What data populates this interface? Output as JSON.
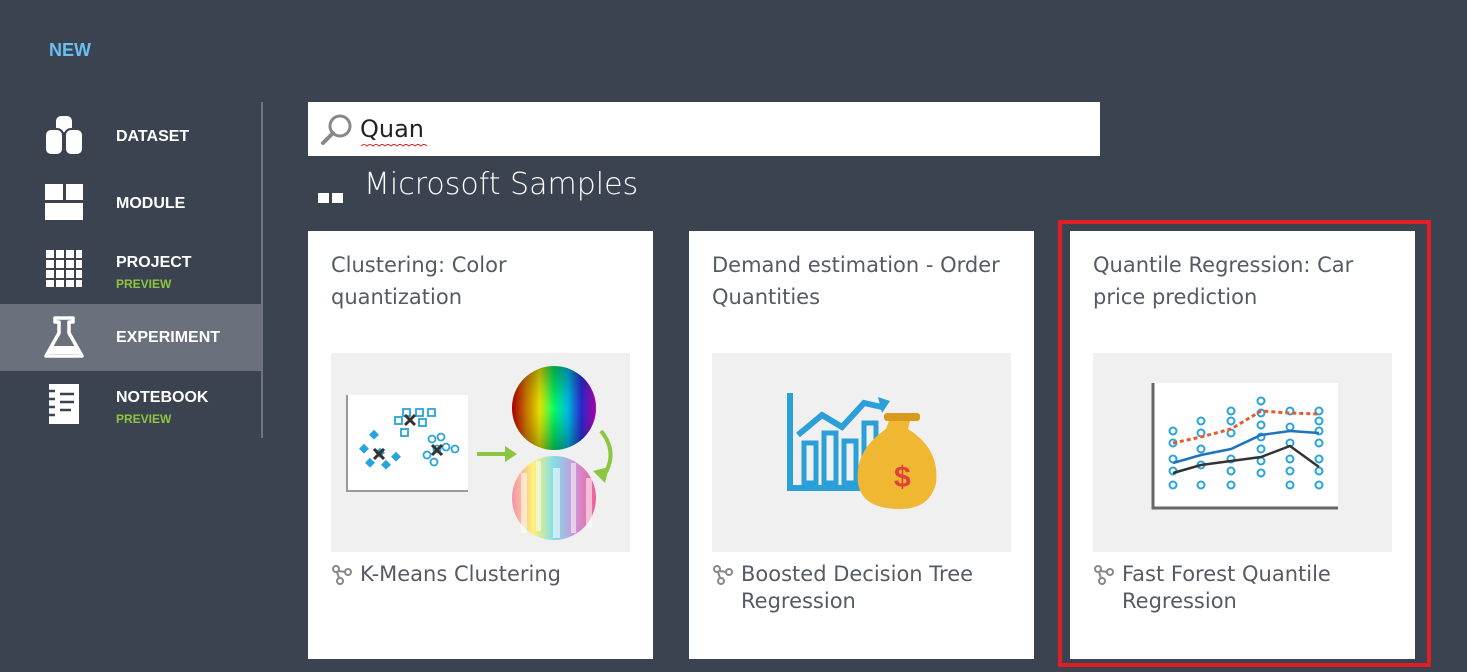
{
  "header": {
    "title": "NEW"
  },
  "nav": {
    "items": [
      {
        "label": "DATASET",
        "sub": "",
        "icon": "dataset-icon",
        "selected": false
      },
      {
        "label": "MODULE",
        "sub": "",
        "icon": "module-icon",
        "selected": false
      },
      {
        "label": "PROJECT",
        "sub": "PREVIEW",
        "icon": "project-icon",
        "selected": false
      },
      {
        "label": "EXPERIMENT",
        "sub": "",
        "icon": "experiment-flask-icon",
        "selected": true
      },
      {
        "label": "NOTEBOOK",
        "sub": "PREVIEW",
        "icon": "notebook-icon",
        "selected": false
      }
    ]
  },
  "search": {
    "value": "Quan",
    "icon": "search-icon"
  },
  "section": {
    "title": "Microsoft Samples"
  },
  "cards": [
    {
      "title": "Clustering: Color quantization",
      "algorithm": "K-Means Clustering",
      "image": "clustering-color-illustration"
    },
    {
      "title": "Demand estimation - Order Quantities",
      "algorithm": "Boosted Decision Tree Regression",
      "image": "demand-chart-moneybag-illustration"
    },
    {
      "title": "Quantile Regression: Car price prediction",
      "algorithm": "Fast Forest Quantile Regression",
      "image": "quantile-regression-plot-illustration"
    }
  ],
  "colors": {
    "background": "#3c4350",
    "nav_selected": "#6b717c",
    "accent_blue": "#69c0f0",
    "preview_green": "#8cc63f",
    "highlight_red": "#e01e26"
  }
}
